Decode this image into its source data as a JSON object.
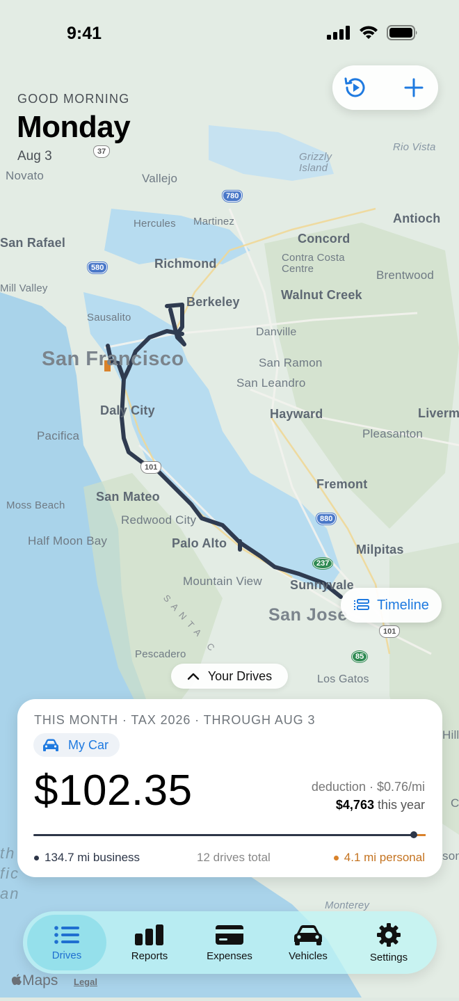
{
  "status_bar": {
    "time": "9:41"
  },
  "header": {
    "greeting": "GOOD MORNING",
    "day": "Monday",
    "date": "Aug 3"
  },
  "map_labels": {
    "vallejo": "Vallejo",
    "novato": "Novato",
    "grizzly": "Grizzly\nIsland",
    "rio_vista": "Rio Vista",
    "hercules": "Hercules",
    "martinez": "Martinez",
    "antioch": "Antioch",
    "san_rafael": "San Rafael",
    "concord": "Concord",
    "richmond": "Richmond",
    "contra_costa": "Contra Costa\nCentre",
    "brentwood": "Brentwood",
    "mill_valley": "Mill Valley",
    "walnut_creek": "Walnut Creek",
    "berkeley": "Berkeley",
    "sausalito": "Sausalito",
    "danville": "Danville",
    "san_francisco": "San Francisco",
    "san_ramon": "San Ramon",
    "san_leandro": "San Leandro",
    "daly_city": "Daly City",
    "hayward": "Hayward",
    "livermore": "Liverm",
    "pacifica": "Pacifica",
    "pleasanton": "Pleasanton",
    "fremont": "Fremont",
    "moss_beach": "Moss Beach",
    "san_mateo": "San Mateo",
    "redwood_city": "Redwood City",
    "half_moon_bay": "Half Moon Bay",
    "milpitas": "Milpitas",
    "palo_alto": "Palo Alto",
    "mountain_view": "Mountain View",
    "sunnyvale": "Sunnyvale",
    "san_jose": "San Jose",
    "pescadero": "Pescadero",
    "los_gatos": "Los Gatos",
    "santa_cruz_mtns": "SANTA C",
    "monterey": "Monterey",
    "hill": "Hill",
    "son": "son",
    "c": "C",
    "ocean": "th\nfic\nan",
    "shield_37": "37",
    "shield_780": "780",
    "shield_580": "580",
    "shield_101a": "101",
    "shield_880": "880",
    "shield_237": "237",
    "shield_101b": "101",
    "shield_85": "85"
  },
  "actions": {
    "playback_icon": "playback-icon",
    "add_icon": "plus-icon"
  },
  "timeline_button": {
    "label": "Timeline"
  },
  "drives_toggle": {
    "label": "Your Drives"
  },
  "summary": {
    "period": "THIS MONTH · TAX 2026 · THROUGH AUG 3",
    "vehicle": "My Car",
    "amount": "$102.35",
    "deduction_rate": "deduction · $0.76/mi",
    "year_total": "$4,763",
    "year_suffix": " this year",
    "business_fraction": 0.97,
    "business": "134.7 mi business",
    "drives_total": "12 drives total",
    "personal": "4.1 mi personal",
    "colors": {
      "business": "#2d3648",
      "personal": "#d9822b",
      "accent": "#1f7ae0"
    }
  },
  "tabs": [
    {
      "label": "Drives",
      "icon": "list-icon",
      "active": true
    },
    {
      "label": "Reports",
      "icon": "bar-chart-icon",
      "active": false
    },
    {
      "label": "Expenses",
      "icon": "card-icon",
      "active": false
    },
    {
      "label": "Vehicles",
      "icon": "car-icon",
      "active": false
    },
    {
      "label": "Settings",
      "icon": "gear-icon",
      "active": false
    }
  ],
  "map_attribution": {
    "logo": "Maps",
    "legal": "Legal"
  }
}
